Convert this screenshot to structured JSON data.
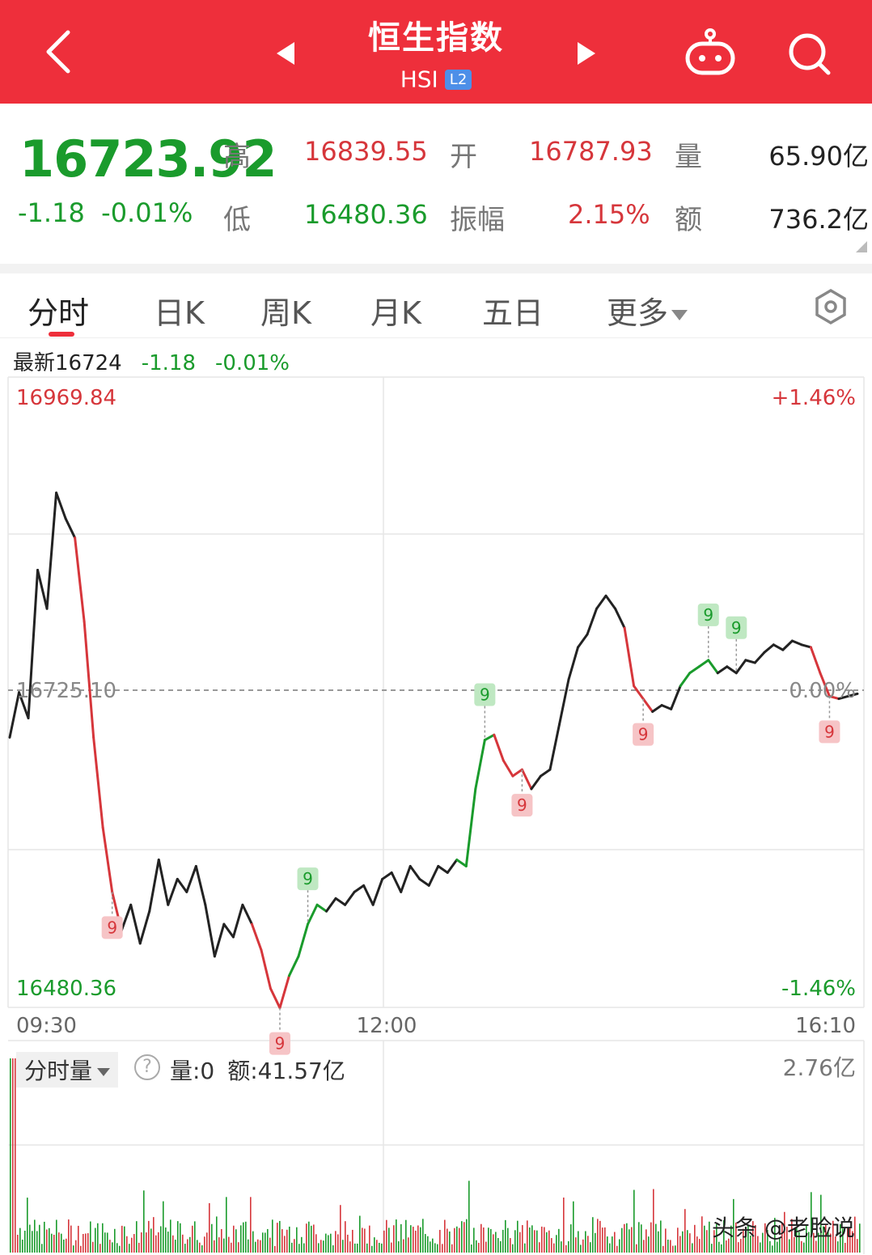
{
  "header": {
    "title": "恒生指数",
    "code": "HSI",
    "badge": "L2"
  },
  "quote": {
    "price": "16723.92",
    "change": "-1.18",
    "change_pct": "-0.01%",
    "high_label": "高",
    "high": "16839.55",
    "low_label": "低",
    "low": "16480.36",
    "open_label": "开",
    "open": "16787.93",
    "amplitude_label": "振幅",
    "amplitude": "2.15%",
    "volume_label": "量",
    "volume": "65.90亿",
    "amount_label": "额",
    "amount": "736.2亿"
  },
  "tabs": [
    {
      "label": "分时",
      "active": true
    },
    {
      "label": "日K"
    },
    {
      "label": "周K"
    },
    {
      "label": "月K"
    },
    {
      "label": "五日"
    },
    {
      "label": "更多"
    }
  ],
  "latest": {
    "label": "最新16724",
    "change": "-1.18",
    "change_pct": "-0.01%"
  },
  "chart": {
    "top_price": "16969.84",
    "top_pct": "+1.46%",
    "ref_price": "16725.10",
    "ref_pct": "0.00%",
    "bottom_price": "16480.36",
    "bottom_pct": "-1.46%",
    "time_start": "09:30",
    "time_mid": "12:00",
    "time_end": "16:10",
    "marker_text": "9"
  },
  "volume": {
    "selector": "分时量",
    "help": "?",
    "vol": "量:0",
    "amount": "额:41.57亿",
    "max": "2.76亿"
  },
  "watermark": "头条 @老脸说",
  "colors": {
    "header_bg": "#ee2f3b",
    "up": "#d6363b",
    "down": "#1a9b2c",
    "line": "#222222"
  },
  "chart_data": {
    "type": "line",
    "ylim": [
      16480.36,
      16969.84
    ],
    "reference": 16725.1,
    "x_ticks": [
      "09:30",
      "12:00",
      "16:10"
    ],
    "points": [
      [
        0,
        16690
      ],
      [
        1,
        16725
      ],
      [
        2,
        16705
      ],
      [
        3,
        16820
      ],
      [
        4,
        16790
      ],
      [
        5,
        16880
      ],
      [
        6,
        16860
      ],
      [
        7,
        16845
      ],
      [
        8,
        16780
      ],
      [
        9,
        16690
      ],
      [
        10,
        16620
      ],
      [
        11,
        16570
      ],
      [
        12,
        16540
      ],
      [
        13,
        16560
      ],
      [
        14,
        16530
      ],
      [
        15,
        16555
      ],
      [
        16,
        16595
      ],
      [
        17,
        16560
      ],
      [
        18,
        16580
      ],
      [
        19,
        16570
      ],
      [
        20,
        16590
      ],
      [
        21,
        16560
      ],
      [
        22,
        16520
      ],
      [
        23,
        16545
      ],
      [
        24,
        16535
      ],
      [
        25,
        16560
      ],
      [
        26,
        16545
      ],
      [
        27,
        16525
      ],
      [
        28,
        16495
      ],
      [
        29,
        16480
      ],
      [
        30,
        16505
      ],
      [
        31,
        16520
      ],
      [
        32,
        16545
      ],
      [
        33,
        16560
      ],
      [
        34,
        16555
      ],
      [
        35,
        16565
      ],
      [
        36,
        16560
      ],
      [
        37,
        16570
      ],
      [
        38,
        16575
      ],
      [
        39,
        16560
      ],
      [
        40,
        16580
      ],
      [
        41,
        16585
      ],
      [
        42,
        16570
      ],
      [
        43,
        16590
      ],
      [
        44,
        16580
      ],
      [
        45,
        16575
      ],
      [
        46,
        16590
      ],
      [
        47,
        16585
      ],
      [
        48,
        16595
      ],
      [
        49,
        16590
      ],
      [
        50,
        16650
      ],
      [
        51,
        16688
      ],
      [
        52,
        16692
      ],
      [
        53,
        16672
      ],
      [
        54,
        16660
      ],
      [
        55,
        16665
      ],
      [
        56,
        16650
      ],
      [
        57,
        16660
      ],
      [
        58,
        16665
      ],
      [
        59,
        16700
      ],
      [
        60,
        16735
      ],
      [
        61,
        16760
      ],
      [
        62,
        16770
      ],
      [
        63,
        16790
      ],
      [
        64,
        16800
      ],
      [
        65,
        16790
      ],
      [
        66,
        16775
      ],
      [
        67,
        16730
      ],
      [
        68,
        16720
      ],
      [
        69,
        16710
      ],
      [
        70,
        16715
      ],
      [
        71,
        16712
      ],
      [
        72,
        16730
      ],
      [
        73,
        16740
      ],
      [
        74,
        16745
      ],
      [
        75,
        16750
      ],
      [
        76,
        16740
      ],
      [
        77,
        16745
      ],
      [
        78,
        16740
      ],
      [
        79,
        16750
      ],
      [
        80,
        16748
      ],
      [
        81,
        16756
      ],
      [
        82,
        16762
      ],
      [
        83,
        16758
      ],
      [
        84,
        16765
      ],
      [
        85,
        16762
      ],
      [
        86,
        16760
      ],
      [
        87,
        16740
      ],
      [
        88,
        16722
      ],
      [
        89,
        16720
      ],
      [
        90,
        16722
      ],
      [
        91,
        16723.92
      ]
    ]
  }
}
